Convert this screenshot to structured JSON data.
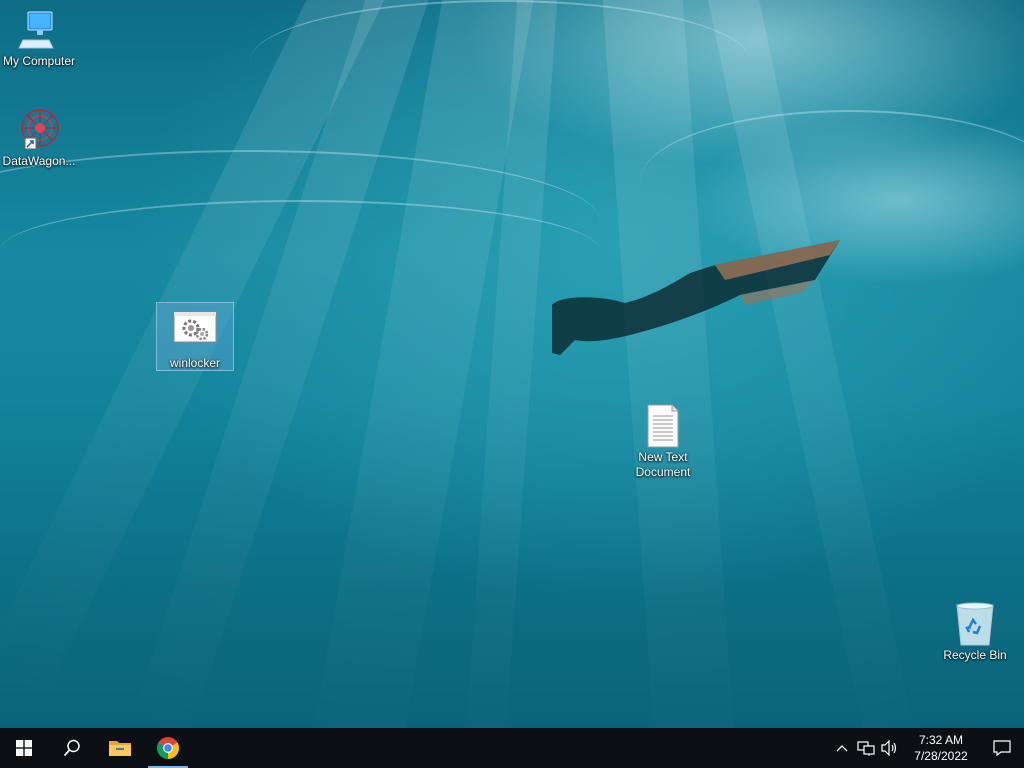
{
  "desktop": {
    "icons": [
      {
        "label": "My Computer",
        "icon": "computer-icon"
      },
      {
        "label": "DataWagon...",
        "icon": "datawagon-icon"
      },
      {
        "label": "winlocker",
        "icon": "executable-gears-icon",
        "selected": true
      },
      {
        "label": "New Text Document",
        "icon": "text-document-icon"
      },
      {
        "label": "Recycle Bin",
        "icon": "recycle-bin-icon"
      }
    ]
  },
  "taskbar": {
    "start": "windows-start-icon",
    "search": "search-icon",
    "pinned": [
      {
        "name": "File Explorer",
        "icon": "folder-icon"
      },
      {
        "name": "Google Chrome",
        "icon": "chrome-icon",
        "active": true
      }
    ],
    "tray": {
      "icons": [
        "chevron-up-icon",
        "network-icon",
        "volume-icon"
      ],
      "time": "7:32 AM",
      "date": "7/28/2022",
      "notification_icon": "notification-icon"
    },
    "accent_color": "#76b9ed"
  }
}
